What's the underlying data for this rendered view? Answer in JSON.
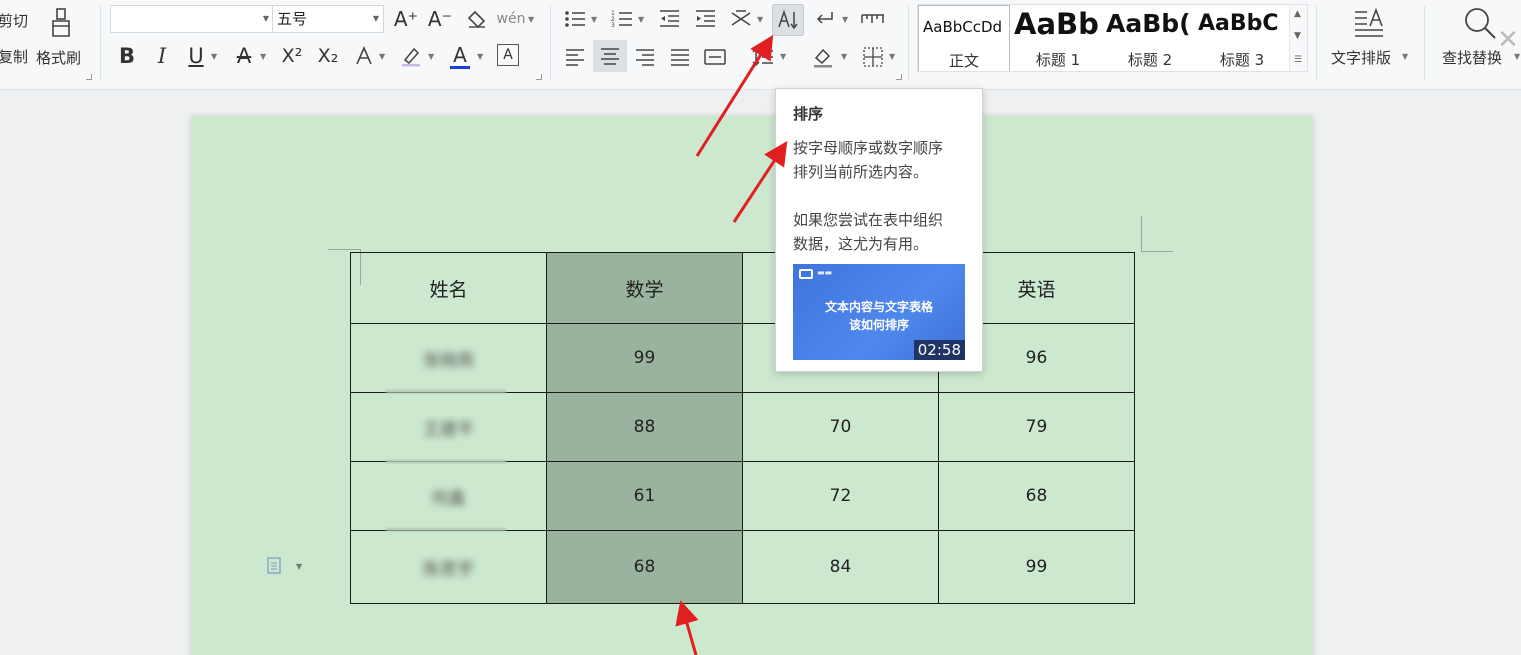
{
  "ribbon": {
    "cut_label": "剪切",
    "copy_label": "复制",
    "format_painter_label": "格式刷",
    "font_name_value": "",
    "font_size_value": "五号",
    "grow_font_icon": "A⁺",
    "shrink_font_icon": "A⁻",
    "pinyin_label": "wén",
    "bold": "B",
    "italic": "I",
    "underline": "U",
    "strikethrough": "A",
    "superscript": "X²",
    "subscript": "X₂",
    "font_color": "A",
    "char_border": "A",
    "styles": [
      {
        "sample": "AaBbCcDd",
        "name": "正文"
      },
      {
        "sample": "AaBb",
        "name": "标题 1"
      },
      {
        "sample": "AaBb(",
        "name": "标题 2"
      },
      {
        "sample": "AaBbC",
        "name": "标题 3"
      }
    ],
    "text_layout_label": "文字排版",
    "find_replace_label": "查找替换"
  },
  "tooltip": {
    "title": "排序",
    "line1": "按字母顺序或数字顺序",
    "line2": "排列当前所选内容。",
    "line3": "如果您尝试在表中组织",
    "line4": "数据，这尤为有用。",
    "video_title_1": "文本内容与文字表格",
    "video_title_2": "该如何排序",
    "video_duration": "02:58"
  },
  "table": {
    "headers": [
      "姓名",
      "数学",
      "",
      "英语"
    ],
    "rows": [
      {
        "name": "张晓雨",
        "math": "99",
        "chinese": "",
        "english": "96"
      },
      {
        "name": "王建平",
        "math": "88",
        "chinese": "70",
        "english": "79"
      },
      {
        "name": "何鑫",
        "math": "61",
        "chinese": "72",
        "english": "68"
      },
      {
        "name": "陈思宇",
        "math": "68",
        "chinese": "84",
        "english": "99"
      }
    ]
  },
  "colors": {
    "page_background": "#cce8cf",
    "selected_column": "#9ab39e",
    "annotation_arrow": "#e02020",
    "thumb_blue": "#4a82e8"
  }
}
